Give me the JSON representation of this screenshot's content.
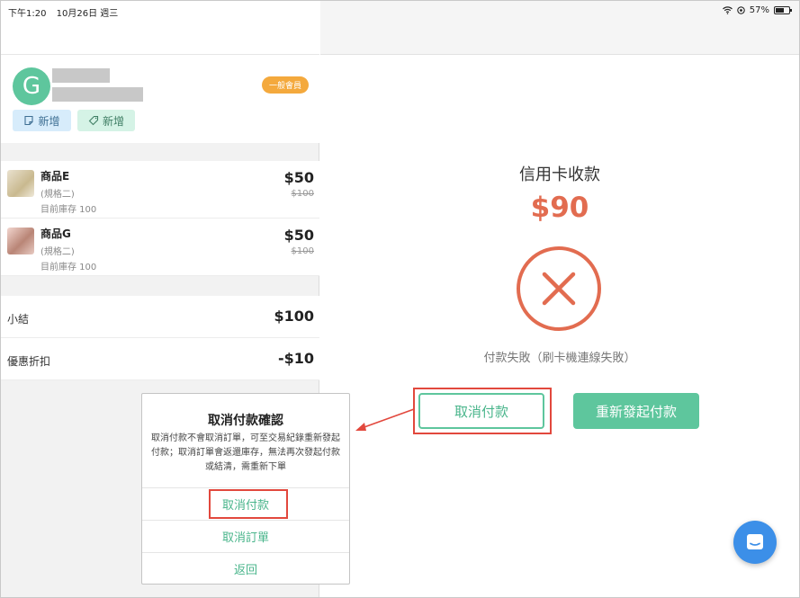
{
  "status_bar": {
    "time": "下午1:20",
    "date": "10月26日 週三",
    "battery": "57%"
  },
  "member": {
    "initial": "G",
    "badge": "一般會員",
    "note_button": "新增",
    "tag_button": "新增"
  },
  "products": [
    {
      "name": "商品E",
      "spec": "(規格二)",
      "stock": "目前庫存 100",
      "price": "$50",
      "original_price": "$100"
    },
    {
      "name": "商品G",
      "spec": "(規格二)",
      "stock": "目前庫存 100",
      "price": "$50",
      "original_price": "$100"
    }
  ],
  "totals": {
    "subtotal_label": "小結",
    "subtotal_value": "$100",
    "discount_label": "優惠折扣",
    "discount_value": "-$10"
  },
  "payment": {
    "title": "信用卡收款",
    "amount": "$90",
    "status": "付款失敗（刷卡機連線失敗）",
    "cancel_button": "取消付款",
    "retry_button": "重新發起付款"
  },
  "dialog": {
    "title": "取消付款確認",
    "message": "取消付款不會取消訂單，可至交易紀錄重新發起付款；取消訂單會返還庫存，無法再次發起付款或結清，需重新下單",
    "options": [
      "取消付款",
      "取消訂單",
      "返回"
    ]
  },
  "colors": {
    "accent": "#5ec69d",
    "danger": "#e26c50",
    "highlight": "#e2483d",
    "chat": "#3c8fe8"
  }
}
